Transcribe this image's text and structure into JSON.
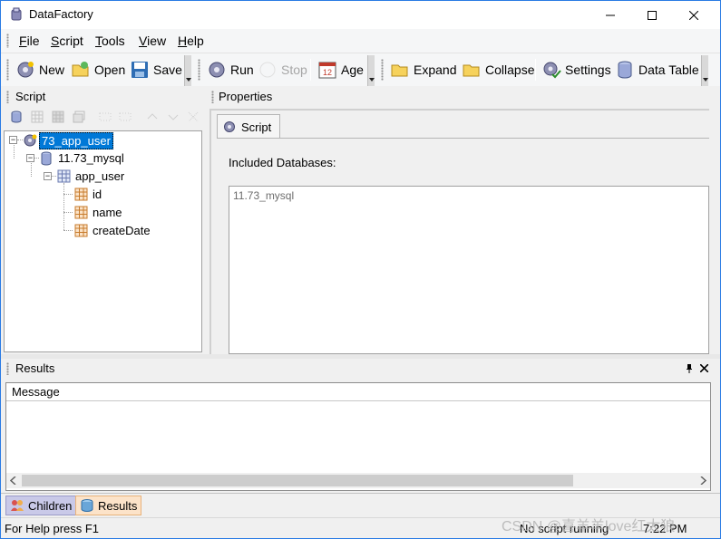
{
  "window": {
    "title": "DataFactory"
  },
  "menu": [
    {
      "mnemonic": "F",
      "rest": "ile"
    },
    {
      "mnemonic": "S",
      "rest": "cript"
    },
    {
      "mnemonic": "T",
      "rest": "ools"
    },
    {
      "mnemonic": "V",
      "rest": "iew"
    },
    {
      "mnemonic": "H",
      "rest": "elp"
    }
  ],
  "toolbar": {
    "new": "New",
    "open": "Open",
    "save": "Save",
    "run": "Run",
    "stop": "Stop",
    "age": "Age",
    "expand": "Expand",
    "collapse": "Collapse",
    "settings": "Settings",
    "data_table": "Data Table"
  },
  "script_panel": {
    "title": "Script",
    "tree": {
      "root": "73_app_user",
      "database": "11.73_mysql",
      "table": "app_user",
      "columns": [
        "id",
        "name",
        "createDate"
      ]
    }
  },
  "properties_panel": {
    "title": "Properties",
    "tab": "Script",
    "included_label": "Included Databases:",
    "databases": [
      "11.73_mysql"
    ]
  },
  "results_panel": {
    "title": "Results",
    "column": "Message"
  },
  "bottom_tabs": {
    "children": "Children",
    "results": "Results"
  },
  "status": {
    "help": "For Help press F1",
    "script_state": "No script running",
    "time": "7:22 PM"
  },
  "watermark": "CSDN @喜羊羊love红太狼",
  "colors": {
    "selection": "#0078d7",
    "window_border": "#2a7be4"
  }
}
